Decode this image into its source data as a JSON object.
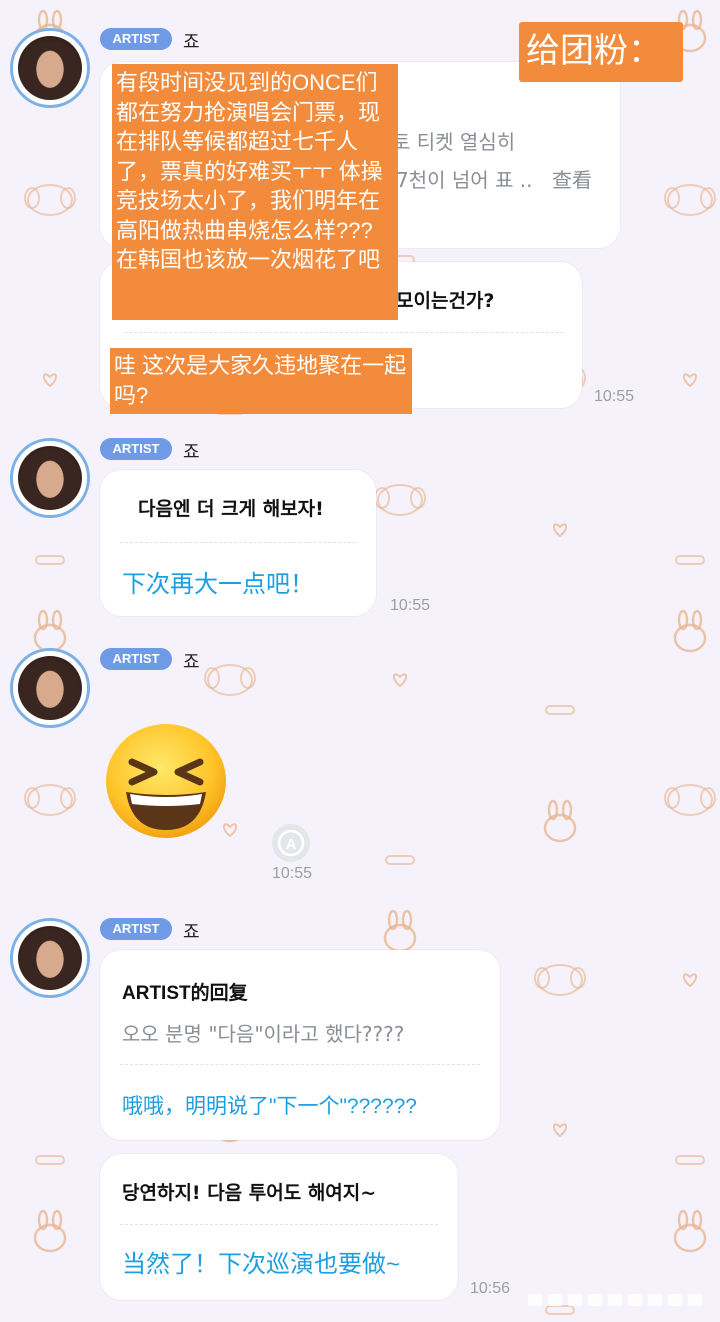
{
  "messages": [
    {
      "badge": "ARTIST",
      "sender": "죠",
      "quoted_partial": "토 티켓 열심히",
      "quoted_partial2": "7천이 넘어 표 ..",
      "view_more": "查看",
      "kor_partial": "모이는건가?",
      "time": "10:55",
      "overlay_translation": "有段时间没见到的ONCE们都在努力抢演唱会门票，现在排队等候都超过七千人了，票真的好难买ㅜㅜ 体操竞技场太小了，我们明年在高阳做热曲串烧怎么样??? 在韩国也该放一次烟花了吧",
      "overlay_translation_2": "哇 这次是大家久违地聚在一起吗?"
    },
    {
      "badge": "ARTIST",
      "sender": "죠",
      "korean": "다음엔 더 크게 해보자!",
      "translation": "下次再大一点吧！",
      "time": "10:55"
    },
    {
      "badge": "ARTIST",
      "sender": "죠",
      "emoji": "😆",
      "time": "10:55"
    },
    {
      "badge": "ARTIST",
      "sender": "죠",
      "reply_title": "ARTIST的回复",
      "reply_quote": "오오 분명 \"다음\"이라고 했다????",
      "reply_translation": "哦哦，明明说了\"下一个\"??????",
      "korean": "당연하지! 다음 투어도 해여지~",
      "translation": "当然了！下次巡演也要做~",
      "time": "10:56"
    }
  ],
  "header_label": "给团粉：",
  "colors": {
    "badge": "#6f9be6",
    "translation": "#1c9ee0",
    "overlay": "#f28b3c",
    "avatar_ring": "#7db1e6",
    "background": "#f6f2fb"
  }
}
